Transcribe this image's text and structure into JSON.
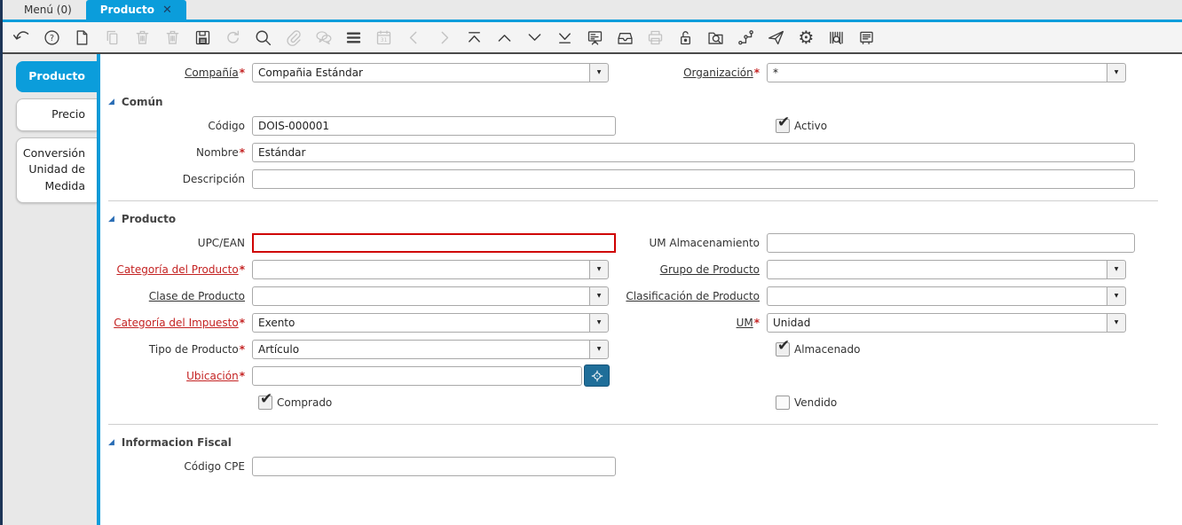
{
  "symbols": {
    "required": "*",
    "dropdown_arrow": "▼",
    "check": "✔",
    "close": "✕",
    "section_marker": "◢",
    "gear": "⚙"
  },
  "window_tabs": {
    "menu": "Menú (0)",
    "producto": "Producto"
  },
  "toolbar": {
    "icons": [
      {
        "name": "undo",
        "disabled": false
      },
      {
        "name": "help",
        "disabled": false
      },
      {
        "name": "new-record",
        "disabled": false
      },
      {
        "name": "copy-record",
        "disabled": true
      },
      {
        "name": "delete-record",
        "disabled": true
      },
      {
        "name": "delete-selection",
        "disabled": true
      },
      {
        "name": "save",
        "disabled": false
      },
      {
        "name": "refresh",
        "disabled": true
      },
      {
        "name": "lookup-record",
        "disabled": false
      },
      {
        "name": "attachment",
        "disabled": true
      },
      {
        "name": "chat",
        "disabled": true
      },
      {
        "name": "grid-toggle",
        "disabled": false
      },
      {
        "name": "calendar",
        "disabled": true
      },
      {
        "name": "previous",
        "disabled": true
      },
      {
        "name": "next",
        "disabled": true
      },
      {
        "name": "first-record",
        "disabled": false
      },
      {
        "name": "previous-record",
        "disabled": false
      },
      {
        "name": "next-record",
        "disabled": false
      },
      {
        "name": "last-record",
        "disabled": false
      },
      {
        "name": "report",
        "disabled": false
      },
      {
        "name": "archive",
        "disabled": false
      },
      {
        "name": "print",
        "disabled": true
      },
      {
        "name": "lock",
        "disabled": false
      },
      {
        "name": "zoom-across",
        "disabled": false
      },
      {
        "name": "workflow",
        "disabled": false
      },
      {
        "name": "send",
        "disabled": false
      },
      {
        "name": "preferences",
        "disabled": false
      },
      {
        "name": "product-search",
        "disabled": false
      },
      {
        "name": "notes",
        "disabled": false
      }
    ]
  },
  "sidebar": {
    "tabs": {
      "producto": "Producto",
      "precio": "Precio",
      "conversion": "Conversión Unidad de Medida"
    }
  },
  "form": {
    "sections": {
      "comun": "Común",
      "producto": "Producto",
      "fiscal": "Informacion Fiscal"
    },
    "compania": {
      "label": "Compañía",
      "value": "Compañia Estándar"
    },
    "organizacion": {
      "label": "Organización",
      "value": "*"
    },
    "codigo": {
      "label": "Código",
      "value": "DOIS-000001"
    },
    "activo": {
      "label": "Activo",
      "checked": true
    },
    "nombre": {
      "label": "Nombre",
      "value": "Estándar"
    },
    "descripcion": {
      "label": "Descripción",
      "value": ""
    },
    "upc": {
      "label": "UPC/EAN",
      "value": ""
    },
    "um_almacenamiento": {
      "label": "UM Almacenamiento",
      "value": ""
    },
    "categoria_producto": {
      "label": "Categoría del Producto",
      "value": ""
    },
    "grupo_producto": {
      "label": "Grupo de Producto",
      "value": ""
    },
    "clase_producto": {
      "label": "Clase de Producto",
      "value": ""
    },
    "clasificacion_producto": {
      "label": "Clasificación de Producto",
      "value": ""
    },
    "categoria_impuesto": {
      "label": "Categoría del Impuesto",
      "value": "Exento"
    },
    "um": {
      "label": "UM",
      "value": "Unidad"
    },
    "tipo_producto": {
      "label": "Tipo de Producto",
      "value": "Artículo"
    },
    "almacenado": {
      "label": "Almacenado",
      "checked": true
    },
    "ubicacion": {
      "label": "Ubicación",
      "value": ""
    },
    "comprado": {
      "label": "Comprado",
      "checked": true
    },
    "vendido": {
      "label": "Vendido",
      "checked": false
    },
    "codigo_cpe": {
      "label": "Código CPE",
      "value": ""
    }
  },
  "colors": {
    "accent": "#0b9ddb",
    "navy_edge": "#1d3557",
    "required_red": "#c42222",
    "error_border": "#cf0000",
    "locate_button": "#1f6e99"
  }
}
